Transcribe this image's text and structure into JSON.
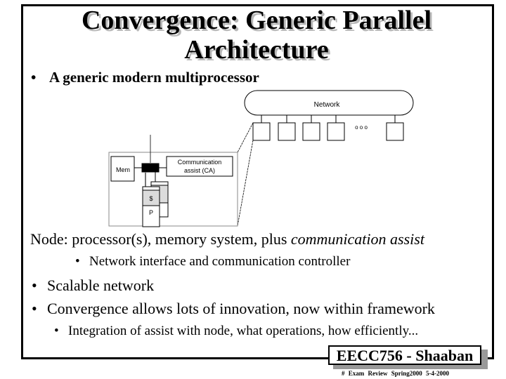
{
  "slide": {
    "title_lines": [
      "Convergence: Generic Parallel",
      "Architecture"
    ],
    "top_bullet": "A generic modern multiprocessor",
    "bullet_glyph": "•",
    "sub_bullet_glyph": "•"
  },
  "diagram": {
    "network_label": "Network",
    "ellipsis_label": "o o o",
    "node_count_visible": 5,
    "mem_label": "Mem",
    "ca_label_line1": "Communication",
    "ca_label_line2": "assist (CA)",
    "cache_label": "$",
    "processor_label": "P"
  },
  "body": {
    "node_prefix": "Node: processor(s), memory system, plus ",
    "node_emphasis": "communication assist",
    "node_sub": "Network interface and communication controller",
    "bullet_scalable": "Scalable network",
    "bullet_convergence": "Convergence allows lots of innovation, now within framework",
    "convergence_sub": "Integration of assist with node, what operations, how efficiently..."
  },
  "footer": {
    "badge": "EECC756 - Shaaban",
    "info": "#  Exam Review  Spring2000  5-4-2000"
  }
}
